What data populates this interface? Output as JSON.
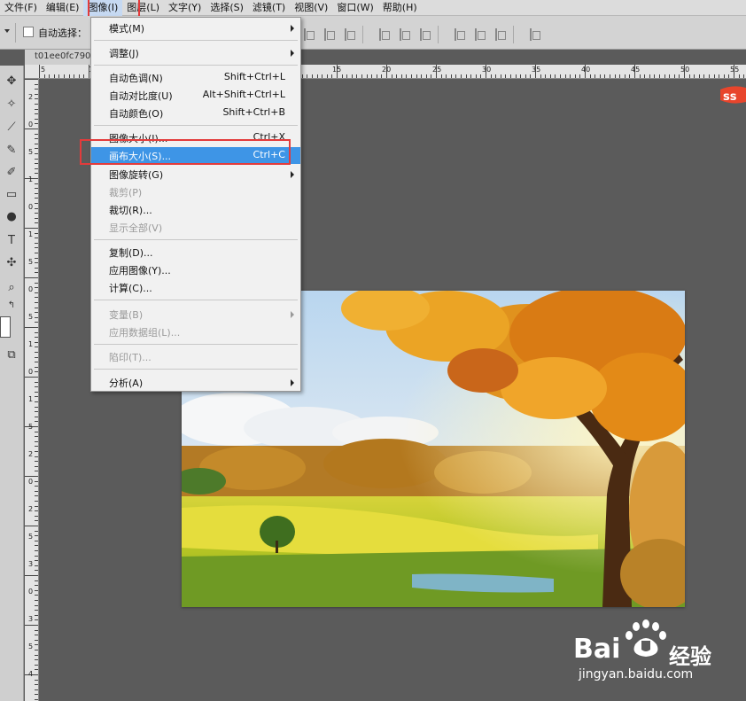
{
  "menubar": {
    "items": [
      "文件(F)",
      "编辑(E)",
      "图像(I)",
      "图层(L)",
      "文字(Y)",
      "选择(S)",
      "滤镜(T)",
      "视图(V)",
      "窗口(W)",
      "帮助(H)"
    ],
    "active_index": 2
  },
  "options": {
    "auto_select_label": "自动选择："
  },
  "document": {
    "tab_title": "t01ee0fc790"
  },
  "rulers": {
    "h_numbers": [
      "5",
      "1",
      "15",
      "20",
      "25",
      "30",
      "35",
      "40",
      "45",
      "50",
      "55"
    ],
    "v_numbers": [
      "2",
      "0",
      "5",
      "1",
      "0",
      "1",
      "5",
      "0",
      "5",
      "1",
      "0",
      "1",
      "5",
      "2",
      "0",
      "2",
      "5",
      "3",
      "0",
      "3",
      "5",
      "4"
    ]
  },
  "image_menu": {
    "items": [
      {
        "label": "模式(M)",
        "shortcut": "",
        "submenu": true,
        "disabled": false,
        "highlight": false
      },
      {
        "label": "调整(J)",
        "shortcut": "",
        "submenu": true,
        "disabled": false,
        "highlight": false
      },
      {
        "label": "自动色调(N)",
        "shortcut": "Shift+Ctrl+L",
        "submenu": false,
        "disabled": false,
        "highlight": false
      },
      {
        "label": "自动对比度(U)",
        "shortcut": "Alt+Shift+Ctrl+L",
        "submenu": false,
        "disabled": false,
        "highlight": false
      },
      {
        "label": "自动颜色(O)",
        "shortcut": "Shift+Ctrl+B",
        "submenu": false,
        "disabled": false,
        "highlight": false
      },
      {
        "label": "图像大小(I)...",
        "shortcut": "Ctrl+X",
        "submenu": false,
        "disabled": false,
        "highlight": false
      },
      {
        "label": "画布大小(S)...",
        "shortcut": "Ctrl+C",
        "submenu": false,
        "disabled": false,
        "highlight": true
      },
      {
        "label": "图像旋转(G)",
        "shortcut": "",
        "submenu": true,
        "disabled": false,
        "highlight": false
      },
      {
        "label": "裁剪(P)",
        "shortcut": "",
        "submenu": false,
        "disabled": true,
        "highlight": false
      },
      {
        "label": "裁切(R)...",
        "shortcut": "",
        "submenu": false,
        "disabled": false,
        "highlight": false
      },
      {
        "label": "显示全部(V)",
        "shortcut": "",
        "submenu": false,
        "disabled": true,
        "highlight": false
      },
      {
        "label": "复制(D)...",
        "shortcut": "",
        "submenu": false,
        "disabled": false,
        "highlight": false
      },
      {
        "label": "应用图像(Y)...",
        "shortcut": "",
        "submenu": false,
        "disabled": false,
        "highlight": false
      },
      {
        "label": "计算(C)...",
        "shortcut": "",
        "submenu": false,
        "disabled": false,
        "highlight": false
      },
      {
        "label": "变量(B)",
        "shortcut": "",
        "submenu": true,
        "disabled": true,
        "highlight": false
      },
      {
        "label": "应用数据组(L)...",
        "shortcut": "",
        "submenu": false,
        "disabled": true,
        "highlight": false
      },
      {
        "label": "陷印(T)...",
        "shortcut": "",
        "submenu": false,
        "disabled": true,
        "highlight": false
      },
      {
        "label": "分析(A)",
        "shortcut": "",
        "submenu": true,
        "disabled": false,
        "highlight": false
      }
    ]
  },
  "watermark": {
    "brand": "Bai",
    "brand_cn": "经验",
    "url": "jingyan.baidu.com"
  },
  "icons": {
    "move": "move-tool-icon",
    "marquee": "magic-wand-icon",
    "eyedropper": "eyedropper-icon",
    "brush": "brush-icon",
    "history": "history-brush-icon",
    "gradient": "gradient-icon",
    "dodge": "dodge-icon",
    "type": "type-tool-icon",
    "stamp": "stamp-icon",
    "zoom": "zoom-icon",
    "swap": "swap-colors-icon",
    "screen_mode": "screen-mode-icon"
  },
  "colors": {
    "highlight": "#3e95e6",
    "annotation_red": "#e33b3b",
    "workspace": "#5b5b5b"
  }
}
